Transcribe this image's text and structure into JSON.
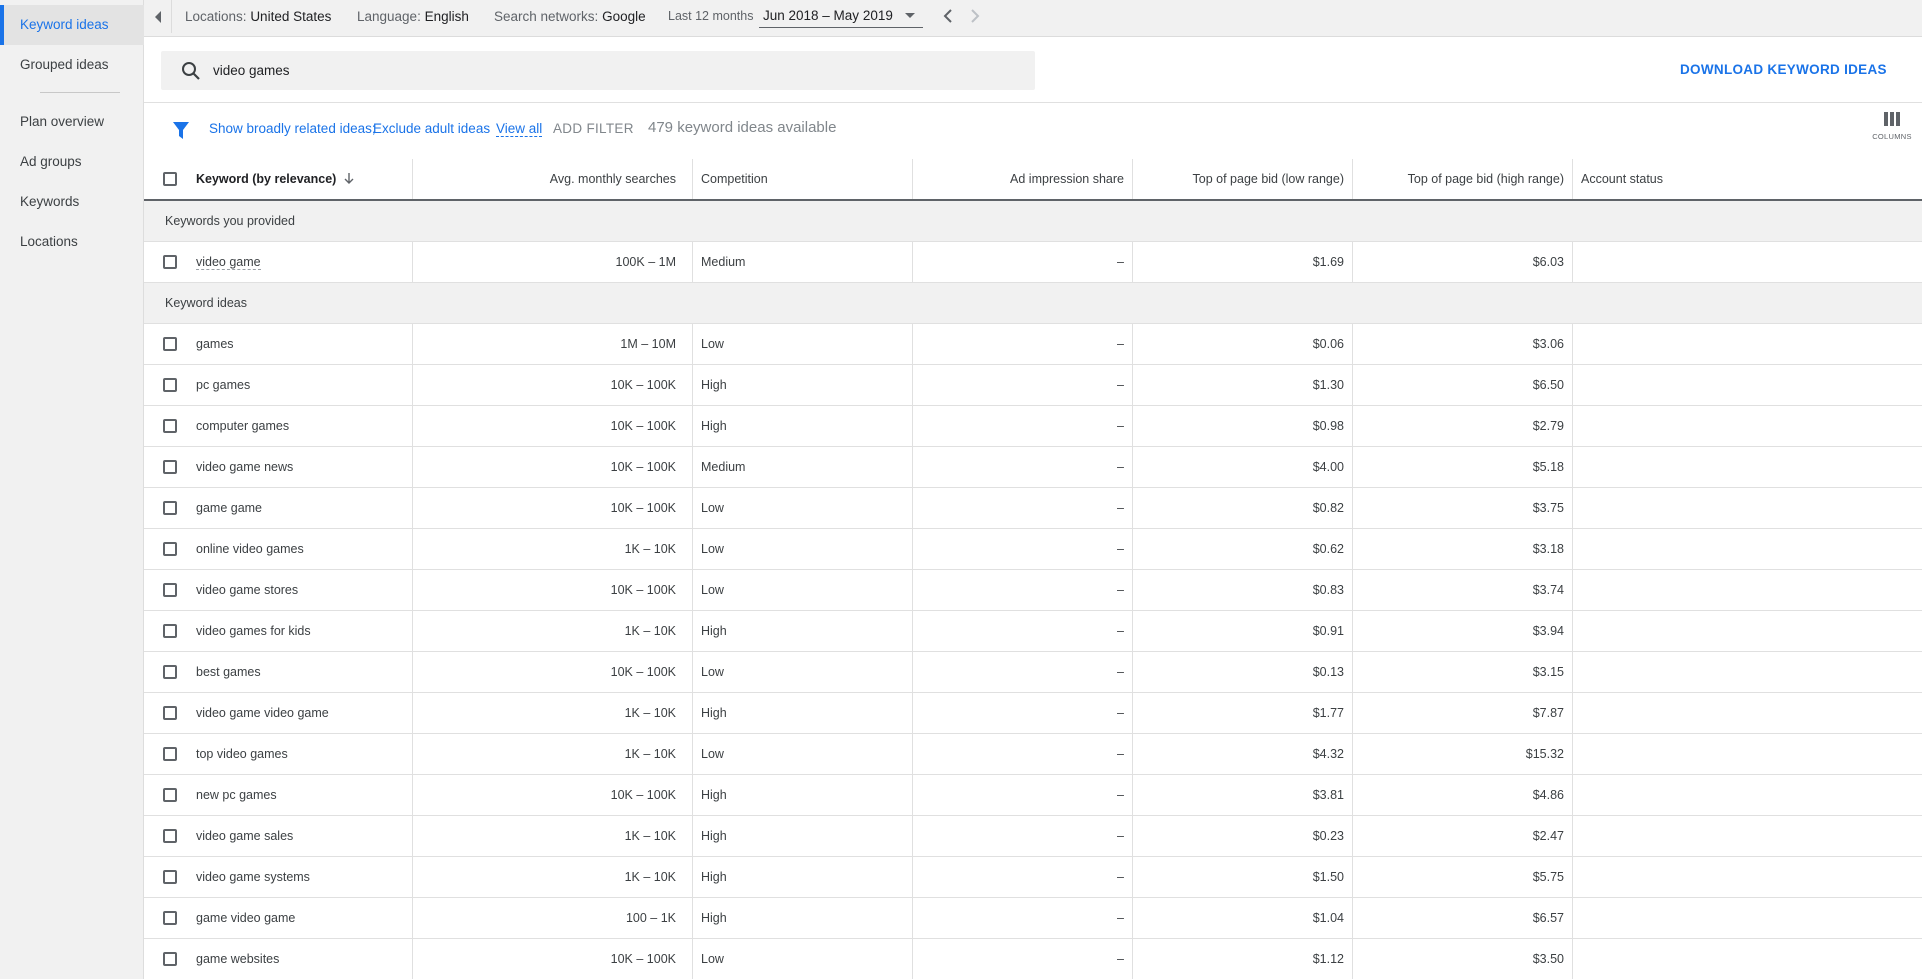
{
  "sidebar": {
    "items": [
      {
        "label": "Keyword ideas",
        "active": true
      },
      {
        "label": "Grouped ideas",
        "active": false
      },
      {
        "label": "Plan overview",
        "active": false
      },
      {
        "label": "Ad groups",
        "active": false
      },
      {
        "label": "Keywords",
        "active": false
      },
      {
        "label": "Locations",
        "active": false
      }
    ]
  },
  "topbar": {
    "locations_label": "Locations:",
    "locations_value": "United States",
    "language_label": "Language:",
    "language_value": "English",
    "networks_label": "Search networks:",
    "networks_value": "Google",
    "period_label": "Last 12 months",
    "date_range": "Jun 2018 – May 2019"
  },
  "search": {
    "value": "video games",
    "download_label": "DOWNLOAD KEYWORD IDEAS"
  },
  "filters": {
    "broadly_related": "Show broadly related ideas;",
    "exclude_adult": "Exclude adult ideas",
    "view_all": "View all",
    "add_filter": "ADD FILTER",
    "count_text": "479 keyword ideas available",
    "columns_label": "COLUMNS"
  },
  "table": {
    "headers": {
      "keyword": "Keyword (by relevance)",
      "avg": "Avg. monthly searches",
      "competition": "Competition",
      "impression": "Ad impression share",
      "low": "Top of page bid (low range)",
      "high": "Top of page bid (high range)",
      "account": "Account status"
    },
    "provided_label": "Keywords you provided",
    "provided": [
      {
        "keyword": "video game",
        "avg": "100K – 1M",
        "competition": "Medium",
        "impression": "–",
        "low": "$1.69",
        "high": "$6.03"
      }
    ],
    "ideas_label": "Keyword ideas",
    "ideas": [
      {
        "keyword": "games",
        "avg": "1M – 10M",
        "competition": "Low",
        "impression": "–",
        "low": "$0.06",
        "high": "$3.06"
      },
      {
        "keyword": "pc games",
        "avg": "10K – 100K",
        "competition": "High",
        "impression": "–",
        "low": "$1.30",
        "high": "$6.50"
      },
      {
        "keyword": "computer games",
        "avg": "10K – 100K",
        "competition": "High",
        "impression": "–",
        "low": "$0.98",
        "high": "$2.79"
      },
      {
        "keyword": "video game news",
        "avg": "10K – 100K",
        "competition": "Medium",
        "impression": "–",
        "low": "$4.00",
        "high": "$5.18"
      },
      {
        "keyword": "game game",
        "avg": "10K – 100K",
        "competition": "Low",
        "impression": "–",
        "low": "$0.82",
        "high": "$3.75"
      },
      {
        "keyword": "online video games",
        "avg": "1K – 10K",
        "competition": "Low",
        "impression": "–",
        "low": "$0.62",
        "high": "$3.18"
      },
      {
        "keyword": "video game stores",
        "avg": "10K – 100K",
        "competition": "Low",
        "impression": "–",
        "low": "$0.83",
        "high": "$3.74"
      },
      {
        "keyword": "video games for kids",
        "avg": "1K – 10K",
        "competition": "High",
        "impression": "–",
        "low": "$0.91",
        "high": "$3.94"
      },
      {
        "keyword": "best games",
        "avg": "10K – 100K",
        "competition": "Low",
        "impression": "–",
        "low": "$0.13",
        "high": "$3.15"
      },
      {
        "keyword": "video game video game",
        "avg": "1K – 10K",
        "competition": "High",
        "impression": "–",
        "low": "$1.77",
        "high": "$7.87"
      },
      {
        "keyword": "top video games",
        "avg": "1K – 10K",
        "competition": "Low",
        "impression": "–",
        "low": "$4.32",
        "high": "$15.32"
      },
      {
        "keyword": "new pc games",
        "avg": "10K – 100K",
        "competition": "High",
        "impression": "–",
        "low": "$3.81",
        "high": "$4.86"
      },
      {
        "keyword": "video game sales",
        "avg": "1K – 10K",
        "competition": "High",
        "impression": "–",
        "low": "$0.23",
        "high": "$2.47"
      },
      {
        "keyword": "video game systems",
        "avg": "1K – 10K",
        "competition": "High",
        "impression": "–",
        "low": "$1.50",
        "high": "$5.75"
      },
      {
        "keyword": "game video game",
        "avg": "100 – 1K",
        "competition": "High",
        "impression": "–",
        "low": "$1.04",
        "high": "$6.57"
      },
      {
        "keyword": "game websites",
        "avg": "10K – 100K",
        "competition": "Low",
        "impression": "–",
        "low": "$1.12",
        "high": "$3.50"
      }
    ]
  },
  "colors": {
    "accent": "#1a73e8",
    "sidebar_bg": "#f1f1f1"
  }
}
